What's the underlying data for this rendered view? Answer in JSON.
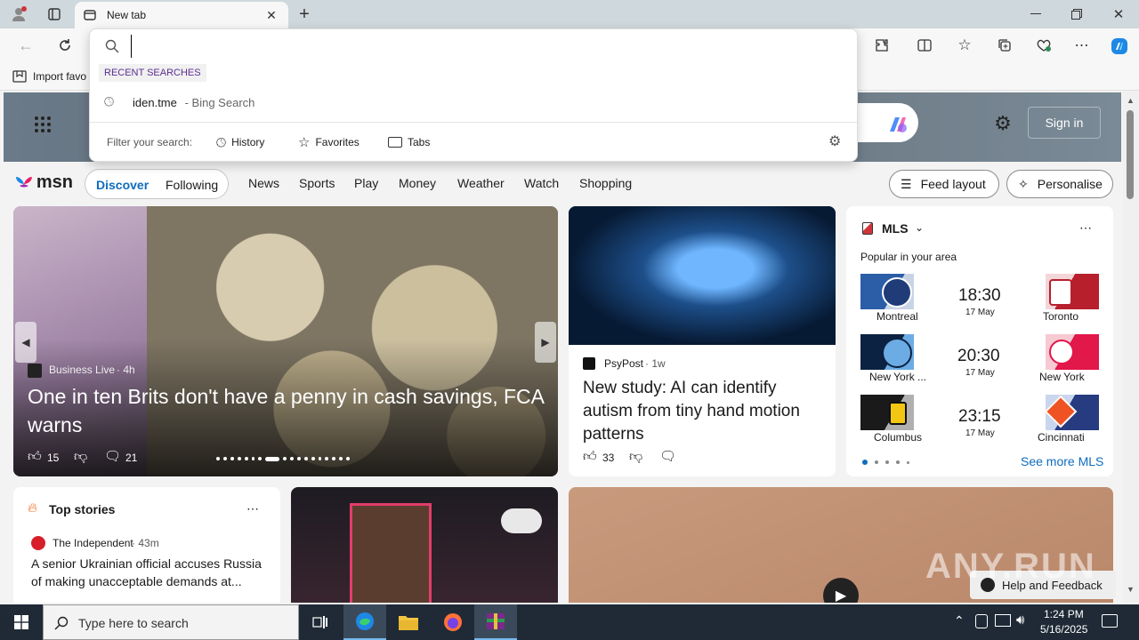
{
  "browser": {
    "tab_title": "New tab",
    "address_value": "",
    "favorites_bar": "Import favo",
    "recent_searches_label": "RECENT SEARCHES",
    "recent_item_query": "iden.tme",
    "recent_item_source": " - Bing Search",
    "filter_label": "Filter your search:",
    "filter_history": "History",
    "filter_favorites": "Favorites",
    "filter_tabs": "Tabs"
  },
  "header": {
    "sign_in": "Sign in"
  },
  "msn": {
    "logo": "msn",
    "tabs": [
      "Discover",
      "Following"
    ],
    "nav": [
      "News",
      "Sports",
      "Play",
      "Money",
      "Weather",
      "Watch",
      "Shopping"
    ],
    "feed_layout": "Feed layout",
    "personalise": "Personalise"
  },
  "hero_story": {
    "source": "Business Live",
    "age": "4h",
    "title": "One in ten Brits don't have a penny in cash savings, FCA warns",
    "likes": "15",
    "comments": "21"
  },
  "side_story": {
    "source": "PsyPost",
    "age": "1w",
    "title": "New study: AI can identify autism from tiny hand motion patterns",
    "likes": "33"
  },
  "mls": {
    "title": "MLS",
    "subtitle": "Popular in your area",
    "see_more": "See more MLS",
    "games": [
      {
        "home": "Montreal",
        "time": "18:30",
        "date": "17 May",
        "away": "Toronto"
      },
      {
        "home": "New York ...",
        "time": "20:30",
        "date": "17 May",
        "away": "New York"
      },
      {
        "home": "Columbus",
        "time": "23:15",
        "date": "17 May",
        "away": "Cincinnati"
      }
    ]
  },
  "top_stories": {
    "title": "Top stories",
    "source": "The Independent",
    "age": "43m",
    "headline": "A senior Ukrainian official accuses Russia of making unacceptable demands at..."
  },
  "help_feedback": "Help and Feedback",
  "taskbar": {
    "search_placeholder": "Type here to search",
    "time": "1:24 PM",
    "date": "5/16/2025"
  }
}
